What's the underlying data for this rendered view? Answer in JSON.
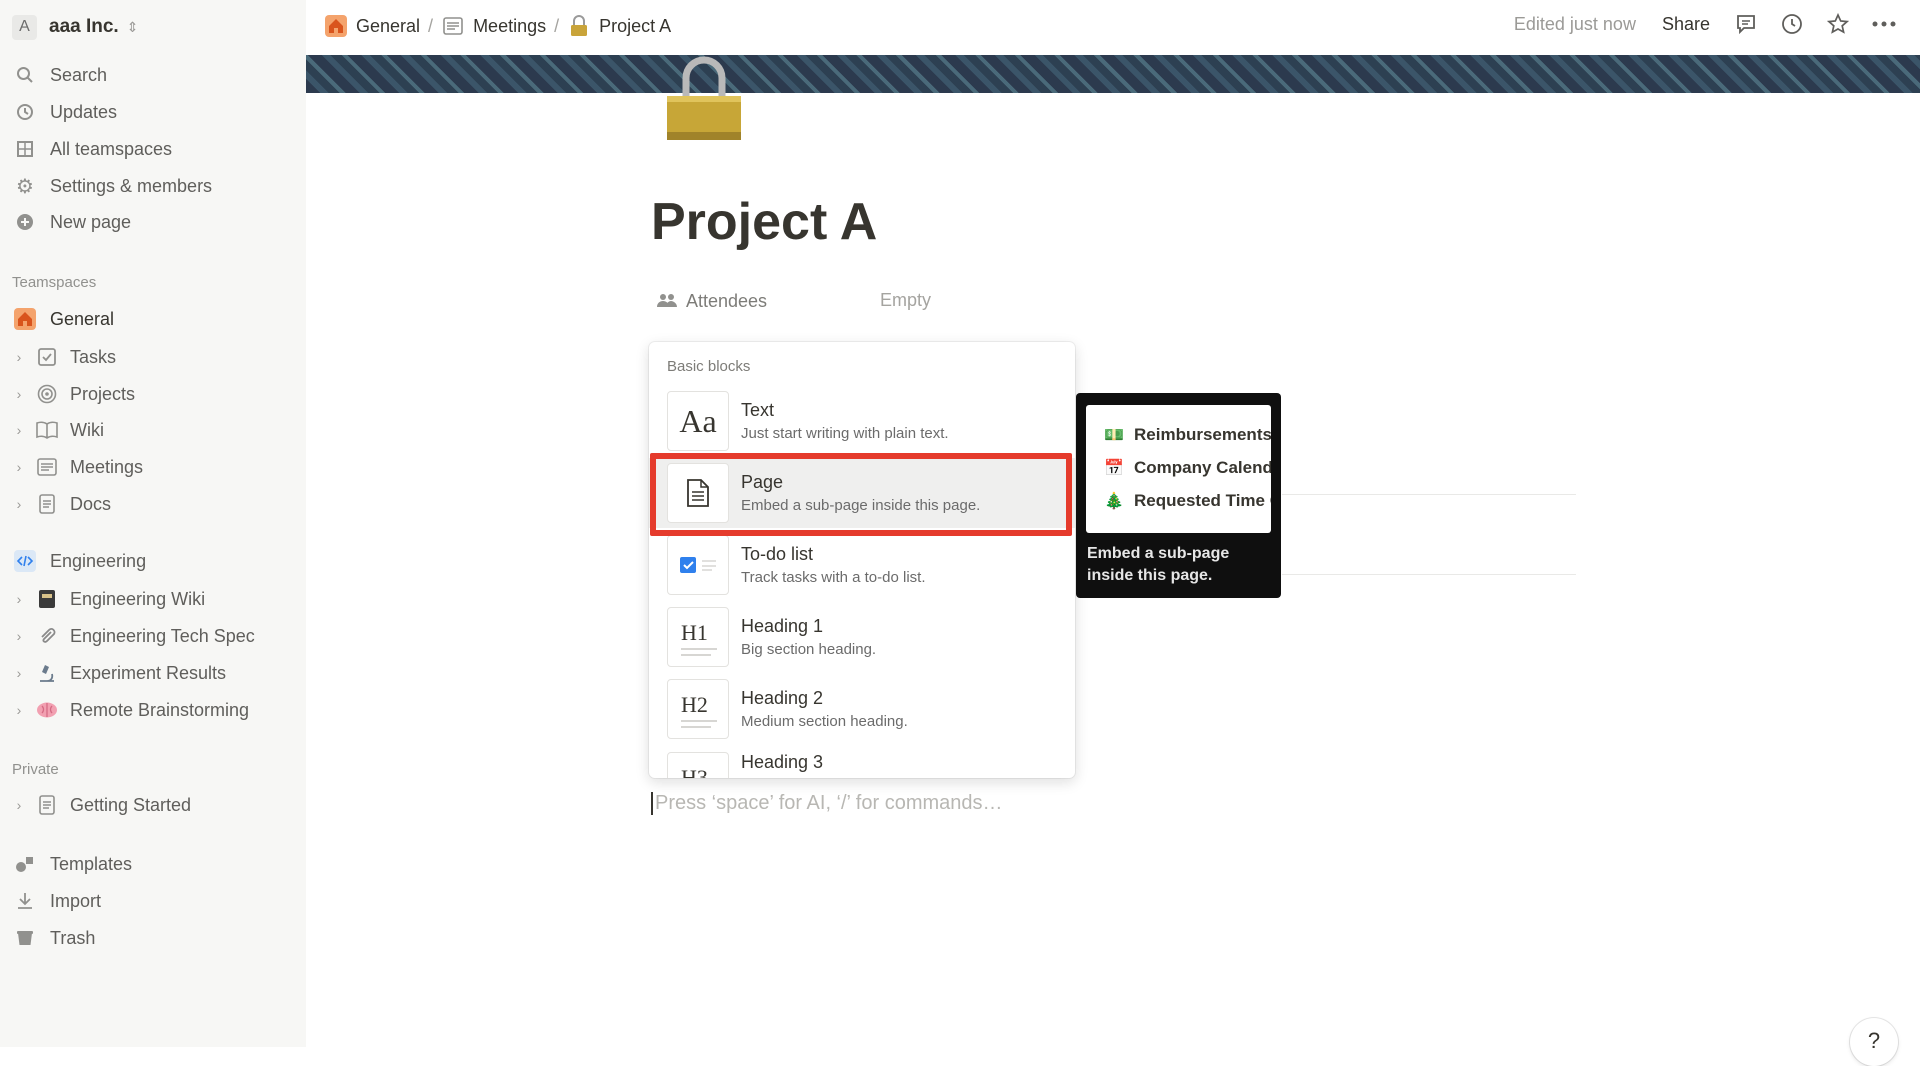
{
  "workspace": {
    "avatar": "A",
    "name": "aaa Inc."
  },
  "sidebar": {
    "top_items": [
      {
        "label": "Search",
        "icon": "search-icon"
      },
      {
        "label": "Updates",
        "icon": "clock-icon"
      },
      {
        "label": "All teamspaces",
        "icon": "building-icon"
      },
      {
        "label": "Settings & members",
        "icon": "gear-icon"
      },
      {
        "label": "New page",
        "icon": "plus-circle-icon"
      }
    ],
    "teamspaces_label": "Teamspaces",
    "general": {
      "label": "General",
      "icon": "house-icon"
    },
    "general_children": [
      {
        "label": "Tasks",
        "icon": "checkbox-icon"
      },
      {
        "label": "Projects",
        "icon": "target-icon"
      },
      {
        "label": "Wiki",
        "icon": "book-icon"
      },
      {
        "label": "Meetings",
        "icon": "notes-icon"
      },
      {
        "label": "Docs",
        "icon": "doc-icon"
      }
    ],
    "engineering": {
      "label": "Engineering",
      "icon": "code-icon"
    },
    "engineering_children": [
      {
        "label": "Engineering Wiki",
        "icon": "notebook-icon"
      },
      {
        "label": "Engineering Tech Spec",
        "icon": "paperclip-icon"
      },
      {
        "label": "Experiment Results",
        "icon": "microscope-icon"
      },
      {
        "label": "Remote Brainstorming",
        "icon": "brain-icon"
      }
    ],
    "private_label": "Private",
    "private_items": [
      {
        "label": "Getting Started",
        "icon": "doc-icon"
      }
    ],
    "bottom_items": [
      {
        "label": "Templates",
        "icon": "shapes-icon"
      },
      {
        "label": "Import",
        "icon": "download-icon"
      },
      {
        "label": "Trash",
        "icon": "trash-icon"
      }
    ]
  },
  "topbar": {
    "breadcrumbs": [
      {
        "label": "General",
        "icon": "house-icon"
      },
      {
        "label": "Meetings",
        "icon": "notes-icon"
      },
      {
        "label": "Project A",
        "icon": "lock-icon"
      }
    ],
    "separator": "/",
    "edited": "Edited just now",
    "share": "Share"
  },
  "page": {
    "title": "Project A",
    "property_label": "Attendees",
    "property_value": "Empty",
    "placeholder": "Press ‘space’ for AI, ‘/’ for commands…"
  },
  "menu": {
    "heading": "Basic blocks",
    "items": [
      {
        "name": "Text",
        "desc": "Just start writing with plain text.",
        "thumb": "Aa"
      },
      {
        "name": "Page",
        "desc": "Embed a sub-page inside this page.",
        "thumb": "page-icon"
      },
      {
        "name": "To-do list",
        "desc": "Track tasks with a to-do list.",
        "thumb": "todo-icon"
      },
      {
        "name": "Heading 1",
        "desc": "Big section heading.",
        "thumb": "H1"
      },
      {
        "name": "Heading 2",
        "desc": "Medium section heading.",
        "thumb": "H2"
      },
      {
        "name": "Heading 3",
        "desc": "",
        "thumb": "H3"
      }
    ]
  },
  "tooltip": {
    "preview_rows": [
      {
        "emoji": "💵",
        "label": "Reimbursements"
      },
      {
        "emoji": "📅",
        "label": "Company Calendar"
      },
      {
        "emoji": "🎄",
        "label": "Requested Time Off"
      }
    ],
    "text": "Embed a sub-page inside this page."
  },
  "help": {
    "label": "?"
  },
  "colors": {
    "highlight": "#e53b2c",
    "accent": "#2f80ed",
    "sidebar_bg": "#f7f7f5"
  }
}
